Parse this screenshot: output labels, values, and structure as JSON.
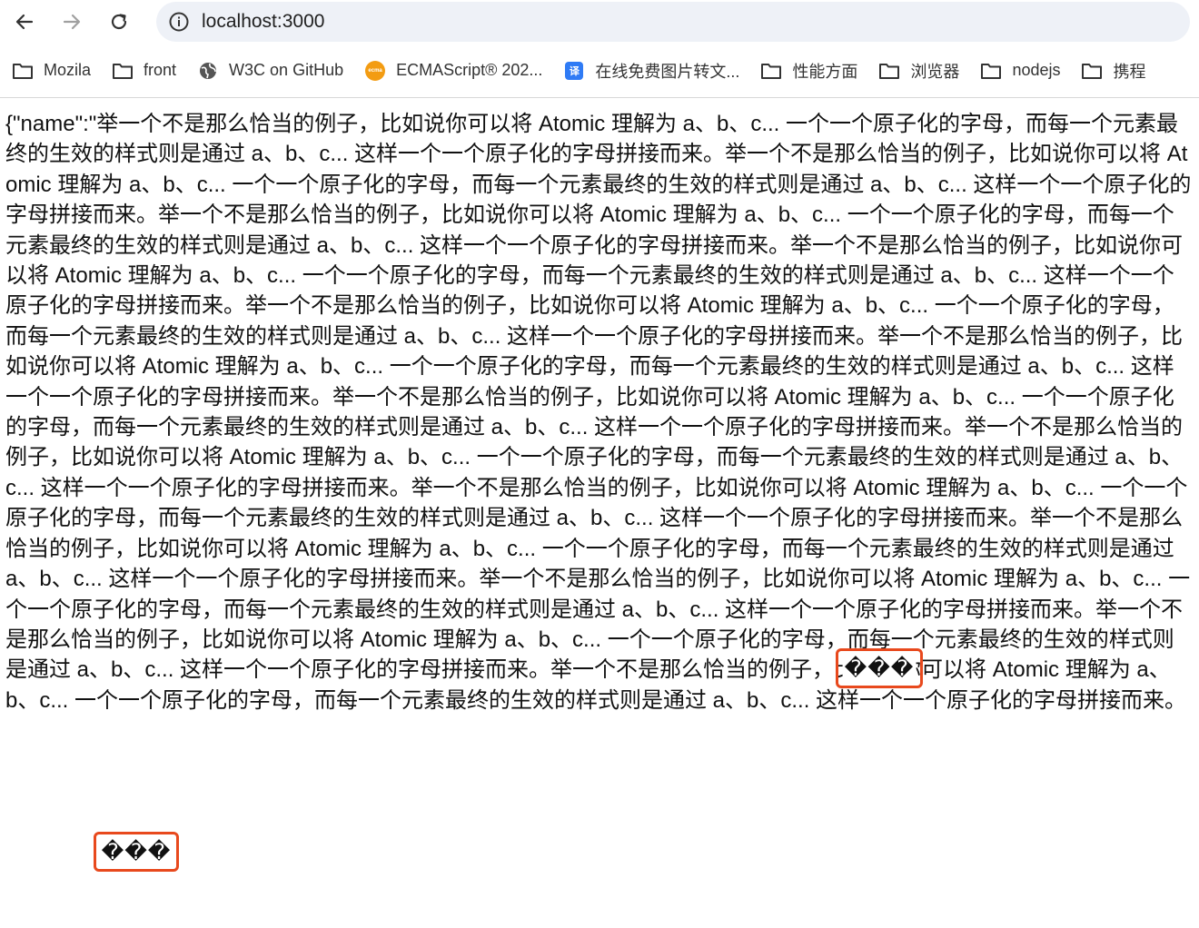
{
  "browser": {
    "url": "localhost:3000"
  },
  "bookmarks": [
    {
      "label": "Mozila",
      "icon": "folder-icon"
    },
    {
      "label": "front",
      "icon": "folder-icon"
    },
    {
      "label": "W3C on GitHub",
      "icon": "globe-icon"
    },
    {
      "label": "ECMAScript® 202...",
      "icon": "ecma-icon"
    },
    {
      "label": "在线免费图片转文...",
      "icon": "image-convert-icon"
    },
    {
      "label": "性能方面",
      "icon": "folder-icon"
    },
    {
      "label": "浏览器",
      "icon": "folder-icon"
    },
    {
      "label": "nodejs",
      "icon": "folder-icon"
    },
    {
      "label": "携程",
      "icon": "folder-icon"
    }
  ],
  "content": {
    "json_prefix": "{\"name\":\"",
    "sentence": "举一个不是那么恰当的例子，比如说你可以将 Atomic 理解为 a、b、c... 一个一个原子化的字母，而每一个元素最终的生效的样式则是通过 a、b、c... 这样一个一个原子化的字母拼接而来。",
    "repeat_count": 13,
    "garbled_marker": "���"
  },
  "colors": {
    "highlight": "#e8491d"
  }
}
